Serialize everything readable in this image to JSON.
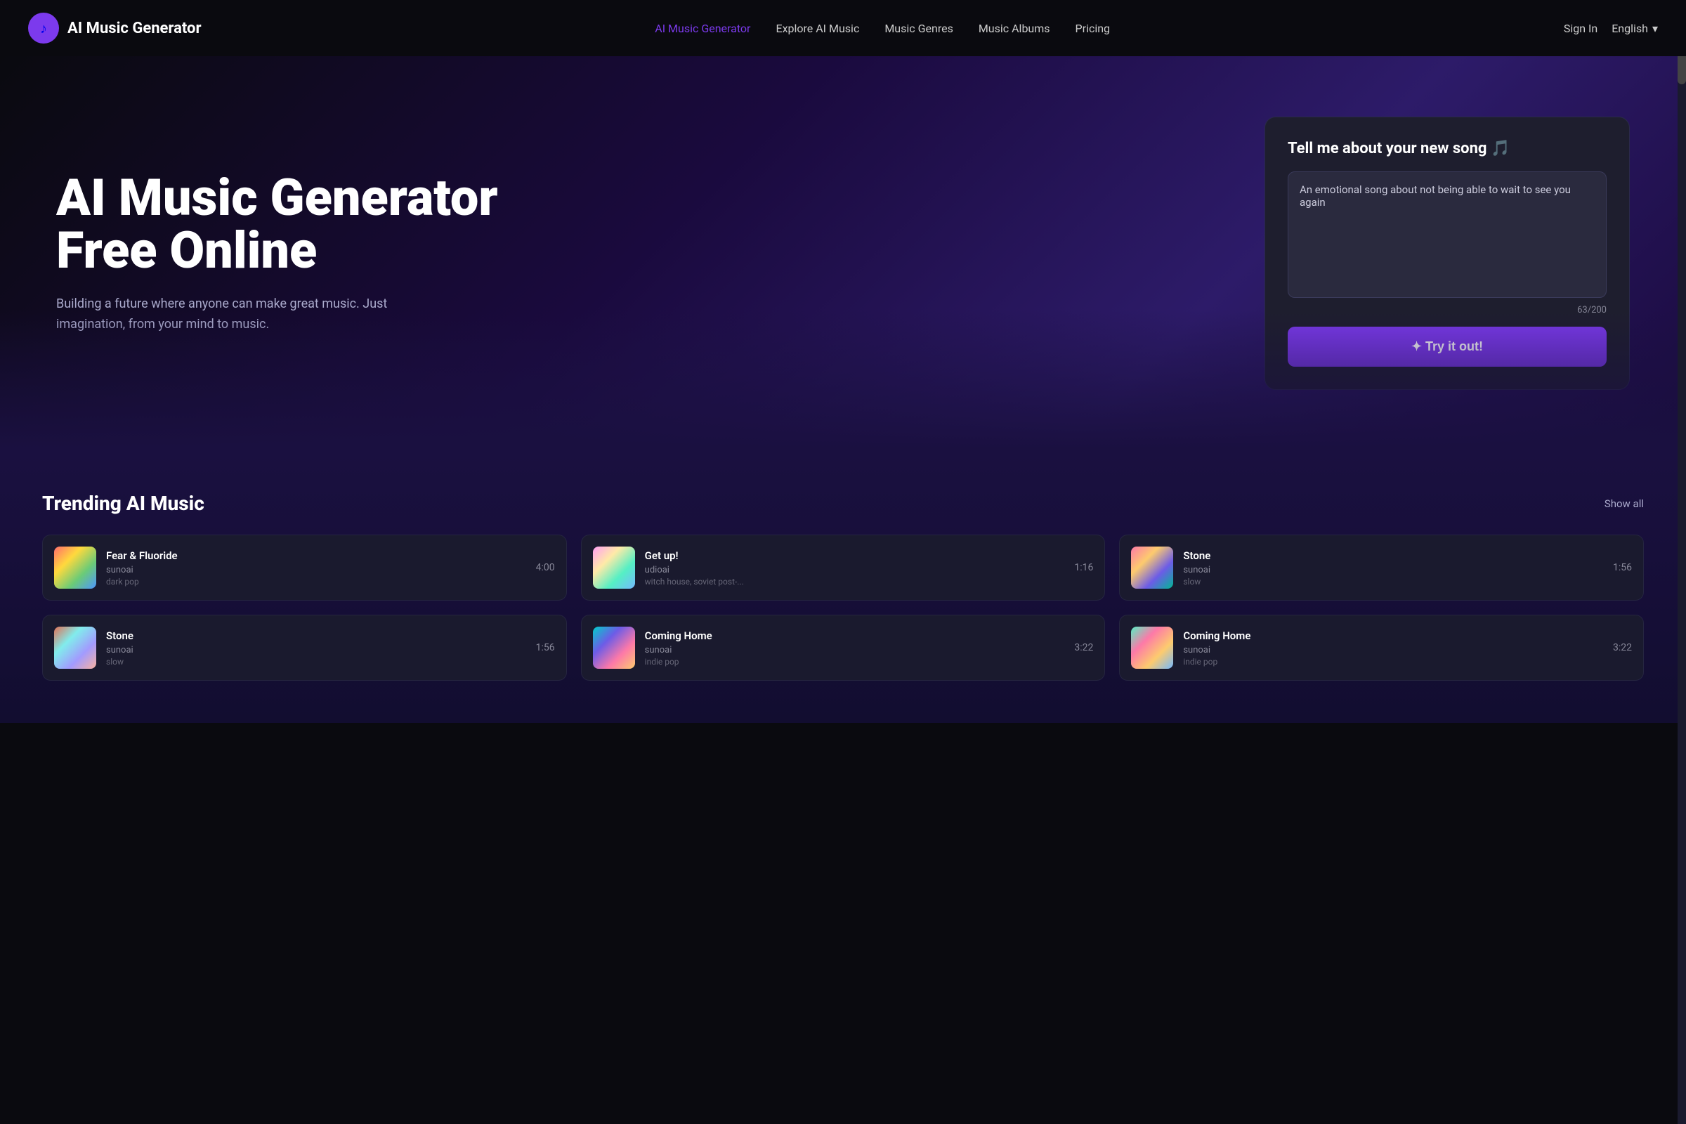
{
  "nav": {
    "logo_icon": "♪",
    "brand_name": "AI Music Generator",
    "links": [
      {
        "id": "ai-music-generator",
        "label": "AI Music Generator",
        "active": true
      },
      {
        "id": "explore-ai-music",
        "label": "Explore AI Music",
        "active": false
      },
      {
        "id": "music-genres",
        "label": "Music Genres",
        "active": false
      },
      {
        "id": "music-albums",
        "label": "Music Albums",
        "active": false
      },
      {
        "id": "pricing",
        "label": "Pricing",
        "active": false
      }
    ],
    "sign_in": "Sign In",
    "language": "English",
    "lang_arrow": "▾"
  },
  "hero": {
    "title": "AI Music Generator Free Online",
    "subtitle": "Building a future where anyone can make great music. Just imagination, from your mind to music.",
    "card": {
      "title": "Tell me about your new song 🎵",
      "textarea_value": "An emotional song about not being able to wait to see you again",
      "textarea_placeholder": "An emotional song about not being able to wait to see you again",
      "char_count": "63/200",
      "try_button": "✦ Try it out!"
    }
  },
  "trending": {
    "title": "Trending AI Music",
    "show_all": "Show all",
    "tracks": [
      {
        "id": 1,
        "name": "Fear & Fluoride",
        "artist": "sunoai",
        "genre": "dark pop",
        "duration": "4:00",
        "thumb_class": "thumb-1"
      },
      {
        "id": 2,
        "name": "Get up!",
        "artist": "udioai",
        "genre": "witch house, soviet post-...",
        "duration": "1:16",
        "thumb_class": "thumb-2"
      },
      {
        "id": 3,
        "name": "Stone",
        "artist": "sunoai",
        "genre": "slow",
        "duration": "1:56",
        "thumb_class": "thumb-3"
      },
      {
        "id": 4,
        "name": "Stone",
        "artist": "sunoai",
        "genre": "slow",
        "duration": "1:56",
        "thumb_class": "thumb-4"
      },
      {
        "id": 5,
        "name": "Coming Home",
        "artist": "sunoai",
        "genre": "indie pop",
        "duration": "3:22",
        "thumb_class": "thumb-5"
      },
      {
        "id": 6,
        "name": "Coming Home",
        "artist": "sunoai",
        "genre": "indie pop",
        "duration": "3:22",
        "thumb_class": "thumb-6"
      }
    ]
  }
}
